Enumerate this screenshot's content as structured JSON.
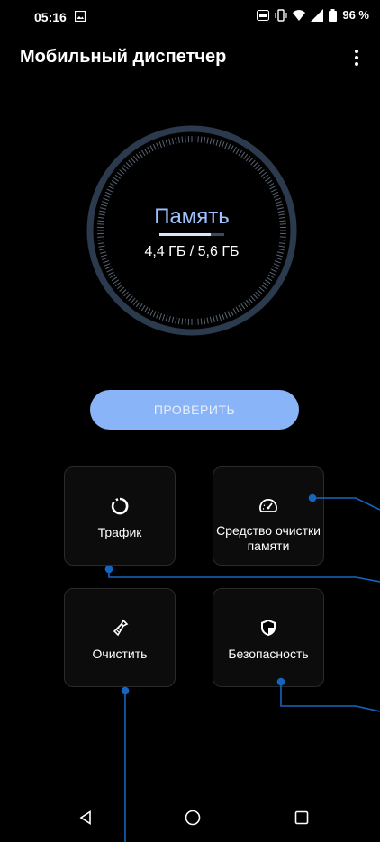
{
  "status_bar": {
    "time": "05:16",
    "battery": "96 %"
  },
  "app_bar": {
    "title": "Мобильный диспетчер"
  },
  "memory": {
    "title": "Память",
    "value": "4,4 ГБ / 5,6 ГБ",
    "used_fraction": 0.79
  },
  "check_button": {
    "label": "ПРОВЕРИТЬ"
  },
  "tiles": [
    {
      "label": "Трафик",
      "icon": "traffic-ring-icon"
    },
    {
      "label": "Средство очистки памяти",
      "icon": "speedometer-icon"
    },
    {
      "label": "Очистить",
      "icon": "broom-icon"
    },
    {
      "label": "Безопасность",
      "icon": "shield-icon"
    }
  ],
  "colors": {
    "accent": "#8ab4f8",
    "callout": "#1565c0",
    "background": "#000000"
  }
}
